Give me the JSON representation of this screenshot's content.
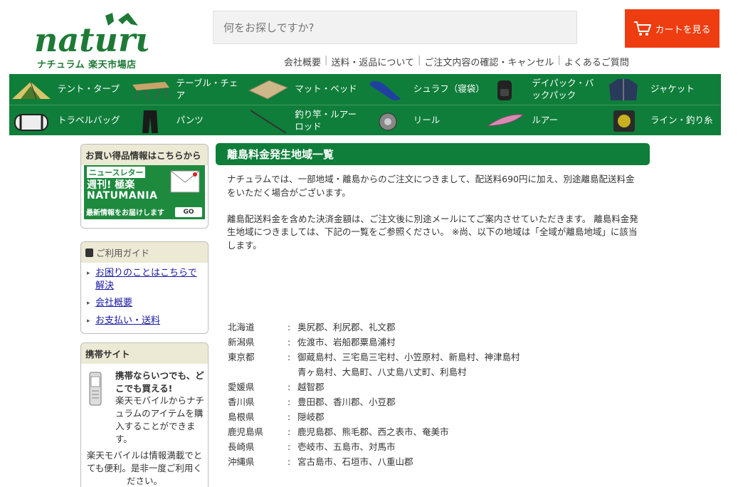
{
  "header": {
    "logo_word": "naturum",
    "logo_sub": "ナチュラム 楽天市場店",
    "search_placeholder": "何をお探しですか?",
    "cart_label": "カートを見る",
    "links": [
      "会社概要",
      "送料・返品について",
      "ご注文内容の確認・キャンセル",
      "よくあるご質問"
    ]
  },
  "categories": {
    "row1": [
      {
        "label": "テント・タープ",
        "icon": "tent-icon"
      },
      {
        "label": "テーブル・チェア",
        "icon": "table-icon"
      },
      {
        "label": "マット・ベッド",
        "icon": "mat-icon"
      },
      {
        "label": "シュラフ（寝袋）",
        "icon": "sleeping-bag-icon"
      },
      {
        "label": "デイパック・バックパック",
        "icon": "backpack-icon"
      },
      {
        "label": "ジャケット",
        "icon": "jacket-icon"
      }
    ],
    "row2": [
      {
        "label": "トラベルバッグ",
        "icon": "duffel-bag-icon"
      },
      {
        "label": "パンツ",
        "icon": "pants-icon"
      },
      {
        "label": "釣り竿・ルアーロッド",
        "icon": "fishing-rod-icon"
      },
      {
        "label": "リール",
        "icon": "reel-icon"
      },
      {
        "label": "ルアー",
        "icon": "lure-icon"
      },
      {
        "label": "ライン・釣り糸",
        "icon": "line-spool-icon"
      }
    ]
  },
  "sidebar": {
    "deals_head": "お買い得品情報はこちらから",
    "banner": {
      "tag": "ニュースレター",
      "line1": "週刊! 極楽",
      "line2": "NATUMANIA",
      "line3": "最新情報をお届けします",
      "go": "GO"
    },
    "guide_head": "ご利用ガイド",
    "guide_items": [
      "お困りのことはこちらで解決",
      "会社概要",
      "お支払い・送料"
    ],
    "mobile_head": "携帯サイト",
    "mobile_bold": "携帯ならいつでも、どこでも買える!",
    "mobile_desc": "楽天モバイルからナチュラムのアイテムを購入することができます。",
    "mobile_desc2": "楽天モバイルは情報満載でとても便利。是非一度ご利用ください。"
  },
  "main": {
    "title": "離島料金発生地域一覧",
    "intro1": "ナチュラムでは、一部地域・離島からのご注文につきまして、配送料690円に加え、別途離島配送料金をいただく場合がございます。",
    "intro2": "離島配送料金を含めた決済金額は、ご注文後に別途メールにてご案内させていただきます。 離島料金発生地域につきましては、下記の一覧をご参照ください。 ※尚、以下の地域は「全域が離島地域」に該当します。",
    "regions": [
      {
        "pref": "北海道",
        "places": "奥尻郡、利尻郡、礼文郡"
      },
      {
        "pref": "新潟県",
        "places": "佐渡市、岩船郡粟島浦村"
      },
      {
        "pref": "東京都",
        "places": "御蔵島村、三宅島三宅村、小笠原村、新島村、神津島村"
      },
      {
        "pref": "",
        "places": "青ヶ島村、大島町、八丈島八丈町、利島村"
      },
      {
        "pref": "愛媛県",
        "places": "越智郡"
      },
      {
        "pref": "香川県",
        "places": "豊田郡、香川郡、小豆郡"
      },
      {
        "pref": "島根県",
        "places": "隠岐郡"
      },
      {
        "pref": "鹿児島県",
        "places": "鹿児島郡、熊毛郡、西之表市、奄美市"
      },
      {
        "pref": "長崎県",
        "places": "壱岐市、五島市、対馬市"
      },
      {
        "pref": "沖縄県",
        "places": "宮古島市、石垣市、八重山郡"
      }
    ]
  }
}
